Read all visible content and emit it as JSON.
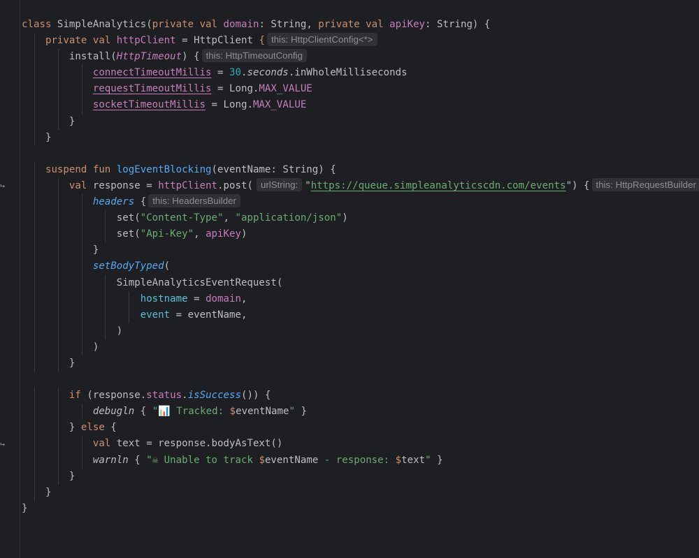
{
  "lines": [
    [
      {
        "t": "class ",
        "c": "kw"
      },
      {
        "t": "SimpleAnalytics("
      },
      {
        "t": "private val ",
        "c": "kw"
      },
      {
        "t": "domain",
        "c": "prop"
      },
      {
        "t": ": String, "
      },
      {
        "t": "private val ",
        "c": "kw"
      },
      {
        "t": "apiKey",
        "c": "prop"
      },
      {
        "t": ": String) {"
      }
    ],
    [
      {
        "t": "    "
      },
      {
        "t": "private val ",
        "c": "kw"
      },
      {
        "t": "httpClient",
        "c": "prop"
      },
      {
        "t": " = HttpClient "
      },
      {
        "t": "{",
        "c": "kw"
      },
      {
        "t": "this: HttpClientConfig<*>",
        "c": "hint"
      }
    ],
    [
      {
        "t": "        install("
      },
      {
        "t": "HttpTimeout",
        "c": "type-i"
      },
      {
        "t": ") {"
      },
      {
        "t": "this: HttpTimeoutConfig",
        "c": "hint"
      }
    ],
    [
      {
        "t": "            "
      },
      {
        "t": "connectTimeoutMillis",
        "c": "prop-u"
      },
      {
        "t": " = "
      },
      {
        "t": "30",
        "c": "num"
      },
      {
        "t": "."
      },
      {
        "t": "seconds",
        "c": "ext-i"
      },
      {
        "t": ".inWholeMilliseconds"
      }
    ],
    [
      {
        "t": "            "
      },
      {
        "t": "requestTimeoutMillis",
        "c": "prop-u"
      },
      {
        "t": " = Long."
      },
      {
        "t": "MAX_VALUE",
        "c": "const"
      }
    ],
    [
      {
        "t": "            "
      },
      {
        "t": "socketTimeoutMillis",
        "c": "prop-u"
      },
      {
        "t": " = Long."
      },
      {
        "t": "MAX_VALUE",
        "c": "const"
      }
    ],
    [
      {
        "t": "        }"
      }
    ],
    [
      {
        "t": "    }"
      }
    ],
    [],
    [
      {
        "t": "    "
      },
      {
        "t": "suspend fun ",
        "c": "kw"
      },
      {
        "t": "logEventBlocking",
        "c": "fn"
      },
      {
        "t": "(eventName: String) {"
      }
    ],
    [
      {
        "t": "        "
      },
      {
        "t": "val ",
        "c": "kw"
      },
      {
        "t": "response = "
      },
      {
        "t": "httpClient",
        "c": "prop"
      },
      {
        "t": ".post("
      },
      {
        "t": "urlString:",
        "c": "hint-arg"
      },
      {
        "t": "\""
      },
      {
        "t": "https://queue.simpleanalyticscdn.com/events",
        "c": "url"
      },
      {
        "t": "\") {",
        "c": "str0"
      },
      {
        "t": "this: HttpRequestBuilder",
        "c": "hint"
      }
    ],
    [
      {
        "t": "            "
      },
      {
        "t": "headers",
        "c": "fn-i"
      },
      {
        "t": " {"
      },
      {
        "t": "this: HeadersBuilder",
        "c": "hint"
      }
    ],
    [
      {
        "t": "                set("
      },
      {
        "t": "\"Content-Type\"",
        "c": "str"
      },
      {
        "t": ", "
      },
      {
        "t": "\"application/json\"",
        "c": "str"
      },
      {
        "t": ")"
      }
    ],
    [
      {
        "t": "                set("
      },
      {
        "t": "\"Api-Key\"",
        "c": "str"
      },
      {
        "t": ", "
      },
      {
        "t": "apiKey",
        "c": "prop"
      },
      {
        "t": ")"
      }
    ],
    [
      {
        "t": "            }"
      }
    ],
    [
      {
        "t": "            "
      },
      {
        "t": "setBodyTyped",
        "c": "fn-i"
      },
      {
        "t": "("
      }
    ],
    [
      {
        "t": "                SimpleAnalyticsEventRequest("
      }
    ],
    [
      {
        "t": "                    "
      },
      {
        "t": "hostname",
        "c": "named"
      },
      {
        "t": " = "
      },
      {
        "t": "domain",
        "c": "prop"
      },
      {
        "t": ","
      }
    ],
    [
      {
        "t": "                    "
      },
      {
        "t": "event",
        "c": "named"
      },
      {
        "t": " = eventName,"
      }
    ],
    [
      {
        "t": "                )"
      }
    ],
    [
      {
        "t": "            )"
      }
    ],
    [
      {
        "t": "        }"
      }
    ],
    [],
    [
      {
        "t": "        "
      },
      {
        "t": "if ",
        "c": "kw"
      },
      {
        "t": "(response."
      },
      {
        "t": "status",
        "c": "prop"
      },
      {
        "t": "."
      },
      {
        "t": "isSuccess",
        "c": "fn-i"
      },
      {
        "t": "()) {"
      }
    ],
    [
      {
        "t": "            "
      },
      {
        "t": "debugln",
        "c": "ext-i"
      },
      {
        "t": " { "
      },
      {
        "t": "\"📊 Tracked: ",
        "c": "str"
      },
      {
        "t": "$",
        "c": "kw"
      },
      {
        "t": "eventName"
      },
      {
        "t": "\"",
        "c": "str"
      },
      {
        "t": " }"
      }
    ],
    [
      {
        "t": "        } "
      },
      {
        "t": "else ",
        "c": "kw"
      },
      {
        "t": "{"
      }
    ],
    [
      {
        "t": "            "
      },
      {
        "t": "val ",
        "c": "kw"
      },
      {
        "t": "text = response.bodyAsText()"
      }
    ],
    [
      {
        "t": "            "
      },
      {
        "t": "warnln",
        "c": "ext-i"
      },
      {
        "t": " { "
      },
      {
        "t": "\"☠ Unable to track ",
        "c": "str"
      },
      {
        "t": "$",
        "c": "kw"
      },
      {
        "t": "eventName"
      },
      {
        "t": " - response: ",
        "c": "str"
      },
      {
        "t": "$",
        "c": "kw"
      },
      {
        "t": "text"
      },
      {
        "t": "\"",
        "c": "str"
      },
      {
        "t": " }"
      }
    ],
    [
      {
        "t": "        }"
      }
    ],
    [
      {
        "t": "    }"
      }
    ],
    [
      {
        "t": "}"
      }
    ]
  ],
  "gutter_icons": [
    {
      "line": 10,
      "icon": "suspend-call-icon",
      "glyph": "↪"
    },
    {
      "line": 26,
      "icon": "suspend-call-icon",
      "glyph": "↪"
    }
  ]
}
